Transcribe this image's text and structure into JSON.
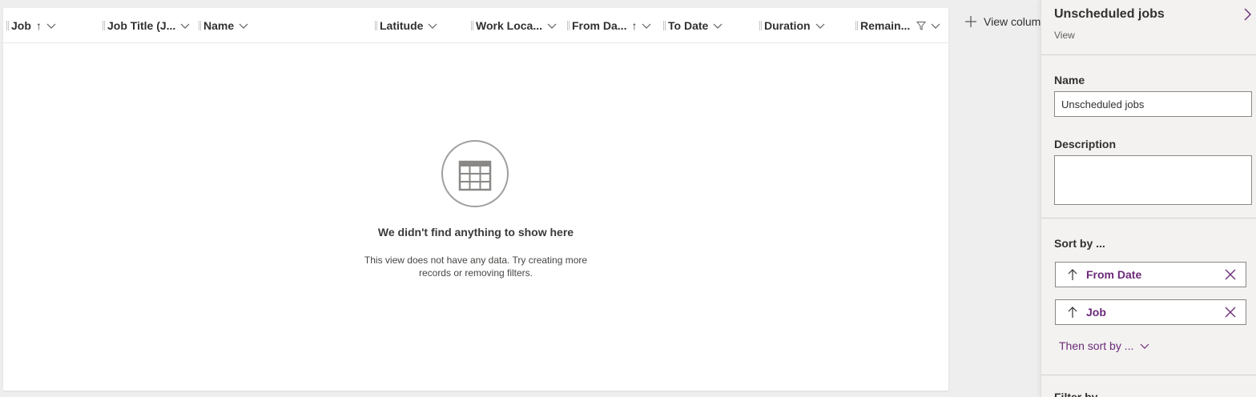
{
  "grid": {
    "columns": [
      {
        "label": "Job",
        "sort": "↑"
      },
      {
        "label": "Job Title (J..."
      },
      {
        "label": "Name"
      },
      {
        "label": "Latitude"
      },
      {
        "label": "Work Loca..."
      },
      {
        "label": "From Da...",
        "sort": "↑"
      },
      {
        "label": "To Date"
      },
      {
        "label": "Duration"
      },
      {
        "label": "Remain..."
      }
    ],
    "empty_title": "We didn't find anything to show here",
    "empty_description": "This view does not have any data. Try creating more records or removing filters.",
    "view_columns_label": "View columns"
  },
  "panel": {
    "title": "Unscheduled jobs",
    "subtitle": "View",
    "name_label": "Name",
    "name_value": "Unscheduled jobs",
    "description_label": "Description",
    "description_value": "",
    "sort_label": "Sort by ...",
    "sort_items": [
      {
        "label": "From Date"
      },
      {
        "label": "Job"
      }
    ],
    "then_sort_label": "Then sort by ...",
    "filter_label": "Filter by"
  },
  "colors": {
    "accent": "#6b2a78",
    "panel_bg": "#f3f2f1",
    "page_bg": "#eeeeee"
  }
}
